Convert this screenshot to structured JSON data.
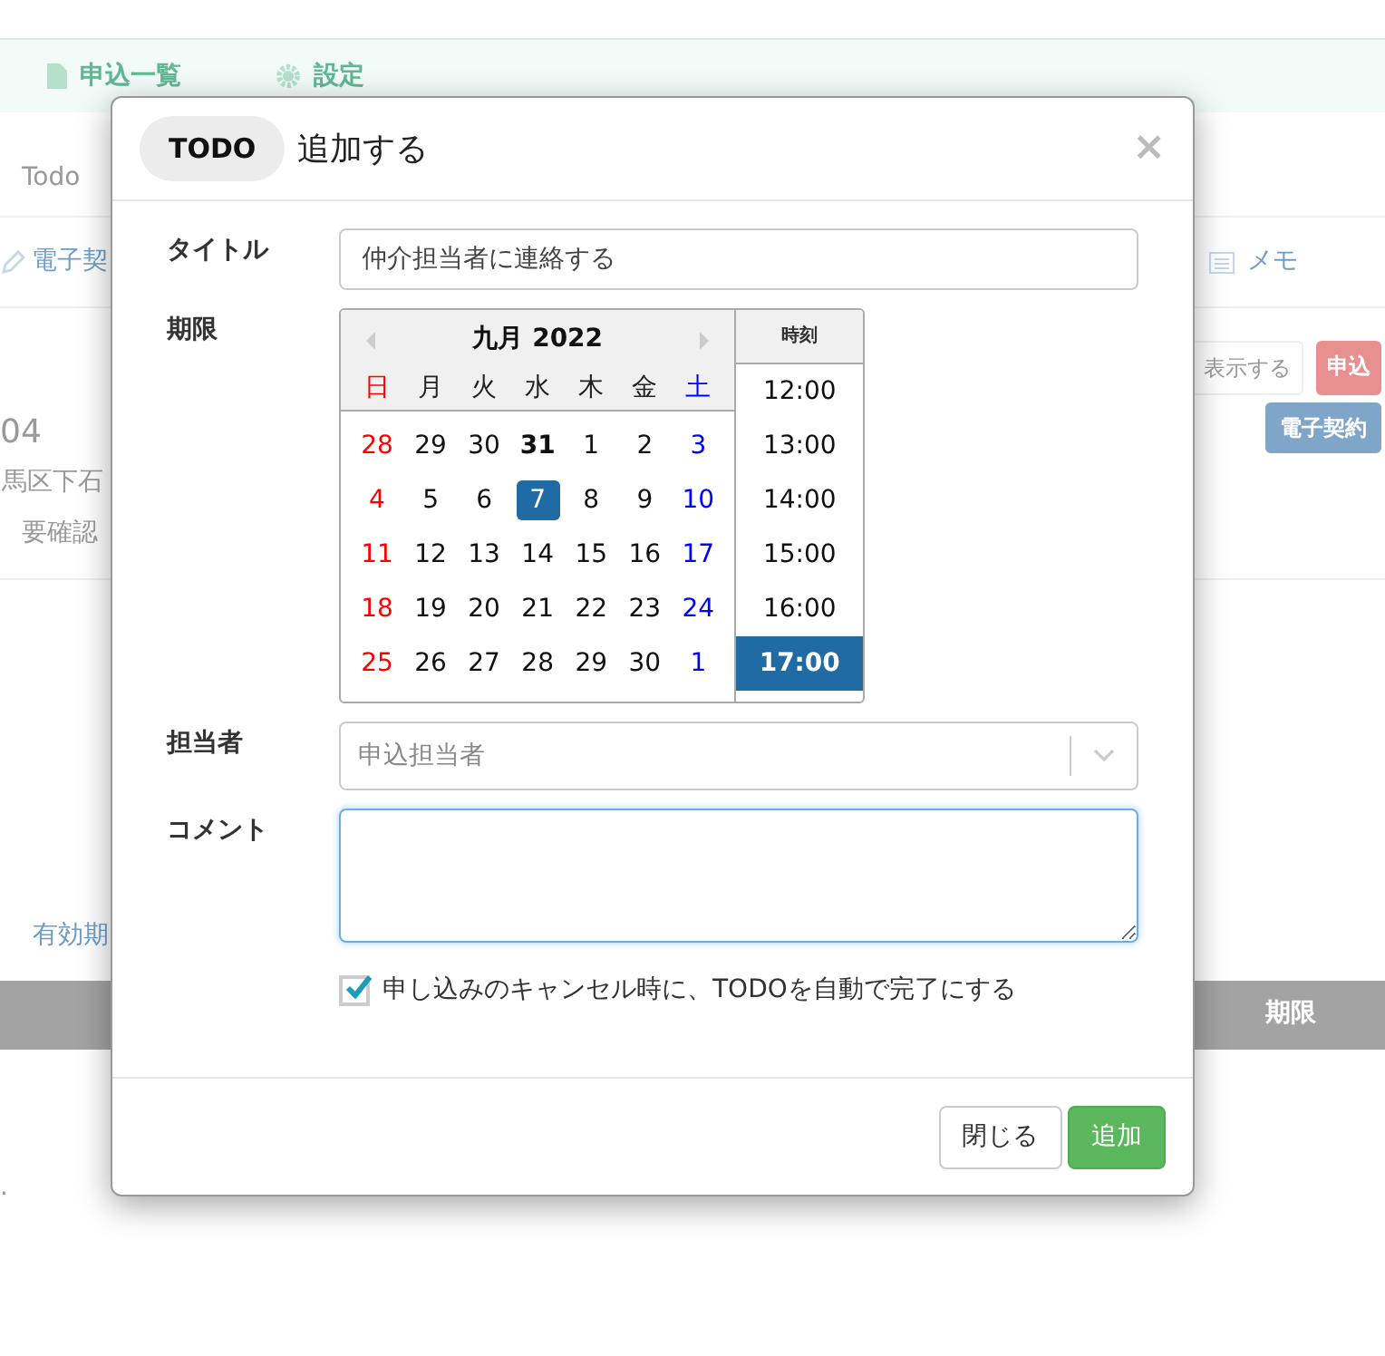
{
  "background": {
    "nav": [
      {
        "label": "申込一覧"
      },
      {
        "label": "設定"
      }
    ],
    "breadcrumb": "Todo",
    "tab_left": "電子契",
    "tab_right": "メモ",
    "buttons": [
      "表示する",
      "申込"
    ],
    "blue_button": "電子契約",
    "heading": "04",
    "address": "馬区下石",
    "status": "要確認",
    "link": "有効期",
    "table_header": "期限",
    "footer_text": "."
  },
  "modal": {
    "badge": "TODO",
    "title": "追加する",
    "close": "×",
    "fields": [
      {
        "kind": "text",
        "label": "タイトル",
        "value": "仲介担当者に連絡する"
      },
      {
        "kind": "datetime",
        "label": "期限"
      },
      {
        "kind": "select",
        "label": "担当者",
        "placeholder": "申込担当者"
      },
      {
        "kind": "textarea",
        "label": "コメント",
        "focused": true
      }
    ],
    "calendar": {
      "month": "九月 2022",
      "weekdays": [
        "日",
        "月",
        "火",
        "水",
        "木",
        "金",
        "土"
      ],
      "weeks": [
        [
          {
            "label": "28",
            "selected": false,
            "bold": false
          },
          {
            "label": "29",
            "selected": false,
            "bold": false
          },
          {
            "label": "30",
            "selected": false,
            "bold": false
          },
          {
            "label": "31",
            "selected": false,
            "bold": true
          },
          {
            "label": "1",
            "selected": false,
            "bold": false
          },
          {
            "label": "2",
            "selected": false,
            "bold": false
          },
          {
            "label": "3",
            "selected": false,
            "bold": false
          }
        ],
        [
          {
            "label": "4",
            "selected": false,
            "bold": false
          },
          {
            "label": "5",
            "selected": false,
            "bold": false
          },
          {
            "label": "6",
            "selected": false,
            "bold": false
          },
          {
            "label": "7",
            "selected": true,
            "bold": false
          },
          {
            "label": "8",
            "selected": false,
            "bold": false
          },
          {
            "label": "9",
            "selected": false,
            "bold": false
          },
          {
            "label": "10",
            "selected": false,
            "bold": false
          }
        ],
        [
          {
            "label": "11",
            "selected": false,
            "bold": false
          },
          {
            "label": "12",
            "selected": false,
            "bold": false
          },
          {
            "label": "13",
            "selected": false,
            "bold": false
          },
          {
            "label": "14",
            "selected": false,
            "bold": false
          },
          {
            "label": "15",
            "selected": false,
            "bold": false
          },
          {
            "label": "16",
            "selected": false,
            "bold": false
          },
          {
            "label": "17",
            "selected": false,
            "bold": false
          }
        ],
        [
          {
            "label": "18",
            "selected": false,
            "bold": false
          },
          {
            "label": "19",
            "selected": false,
            "bold": false
          },
          {
            "label": "20",
            "selected": false,
            "bold": false
          },
          {
            "label": "21",
            "selected": false,
            "bold": false
          },
          {
            "label": "22",
            "selected": false,
            "bold": false
          },
          {
            "label": "23",
            "selected": false,
            "bold": false
          },
          {
            "label": "24",
            "selected": false,
            "bold": false
          }
        ],
        [
          {
            "label": "25",
            "selected": false,
            "bold": false
          },
          {
            "label": "26",
            "selected": false,
            "bold": false
          },
          {
            "label": "27",
            "selected": false,
            "bold": false
          },
          {
            "label": "28",
            "selected": false,
            "bold": false
          },
          {
            "label": "29",
            "selected": false,
            "bold": false
          },
          {
            "label": "30",
            "selected": false,
            "bold": false
          },
          {
            "label": "1",
            "selected": false,
            "bold": false
          }
        ]
      ],
      "time_header": "時刻",
      "times": [
        {
          "label": "12:00",
          "selected": false
        },
        {
          "label": "13:00",
          "selected": false
        },
        {
          "label": "14:00",
          "selected": false
        },
        {
          "label": "15:00",
          "selected": false
        },
        {
          "label": "16:00",
          "selected": false
        },
        {
          "label": "17:00",
          "selected": true
        }
      ]
    },
    "checkbox": {
      "label": "申し込みのキャンセル時に、TODOを自動で完了にする",
      "checked": true
    },
    "buttons": [
      {
        "label": "閉じる",
        "kind": "secondary"
      },
      {
        "label": "追加",
        "kind": "primary"
      }
    ]
  }
}
